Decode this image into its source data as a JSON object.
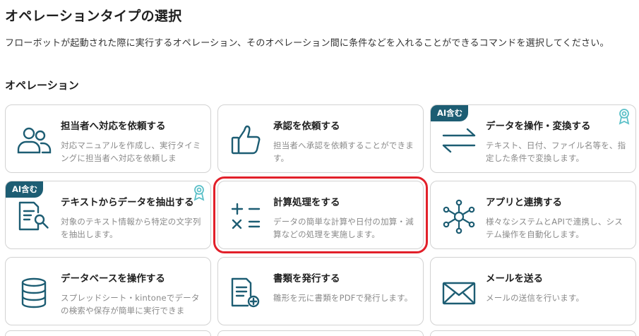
{
  "page": {
    "title": "オペレーションタイプの選択",
    "description": "フローボットが起動された際に実行するオペレーション、そのオペレーション間に条件などを入れることができるコマンドを選択してください。"
  },
  "section": {
    "title": "オペレーション"
  },
  "colors": {
    "icon": "#1d5d73",
    "badge": "#1d5d73",
    "selected_border": "#e2202a",
    "award": "#5bc0c8"
  },
  "cards": [
    {
      "title": "担当者へ対応を依頼する",
      "description": "対応マニュアルを作成し、実行タイミングに担当者へ対応を依頼しま",
      "icon": "people-icon"
    },
    {
      "title": "承認を依頼する",
      "description": "担当者へ承認を依頼することができます。",
      "icon": "thumbs-up-icon"
    },
    {
      "title": "データを操作・変換する",
      "description": "テキスト、日付、ファイル名等を、指定した条件で変換します。",
      "icon": "transform-arrows-icon",
      "badge": "AI含む"
    },
    {
      "title": "テキストからデータを抽出する",
      "description": "対象のテキスト情報から特定の文字列を抽出します。",
      "icon": "document-search-icon",
      "badge": "AI含む"
    },
    {
      "title": "計算処理をする",
      "description": "データの簡単な計算や日付の加算・減算などの処理を実施します。",
      "icon": "calculator-icon",
      "selected": true
    },
    {
      "title": "アプリと連携する",
      "description": "様々なシステムとAPIで連携し、システム操作を自動化します。",
      "icon": "network-icon"
    },
    {
      "title": "データベースを操作する",
      "description": "スプレッドシート・kintoneでデータの検索や保存が簡単に実行できま",
      "icon": "database-icon"
    },
    {
      "title": "書類を発行する",
      "description": "雛形を元に書類をPDFで発行します。",
      "icon": "document-add-icon"
    },
    {
      "title": "メールを送る",
      "description": "メールの送信を行います。",
      "icon": "mail-icon"
    }
  ]
}
